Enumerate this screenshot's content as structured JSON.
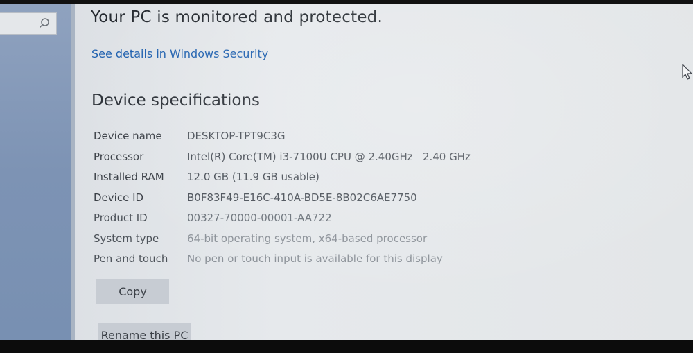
{
  "search": {
    "icon": "search-icon"
  },
  "security": {
    "heading": "Your PC is monitored and protected.",
    "link": "See details in Windows Security"
  },
  "specs": {
    "title": "Device specifications",
    "rows": [
      {
        "label": "Device name",
        "value": "DESKTOP-TPT9C3G"
      },
      {
        "label": "Processor",
        "value": "Intel(R) Core(TM) i3-7100U CPU @ 2.40GHz   2.40 GHz"
      },
      {
        "label": "Installed RAM",
        "value": "12.0 GB (11.9 GB usable)"
      },
      {
        "label": "Device ID",
        "value": "B0F83F49-E16C-410A-BD5E-8B02C6AE7750"
      },
      {
        "label": "Product ID",
        "value": "00327-70000-00001-AA722"
      },
      {
        "label": "System type",
        "value": "64-bit operating system, x64-based processor"
      },
      {
        "label": "Pen and touch",
        "value": "No pen or touch input is available for this display"
      }
    ]
  },
  "buttons": {
    "copy": "Copy",
    "rename": "Rename this PC"
  },
  "colors": {
    "link": "#1d5fae",
    "sidebar": "#7d93b4",
    "background": "#e4e7ea"
  }
}
